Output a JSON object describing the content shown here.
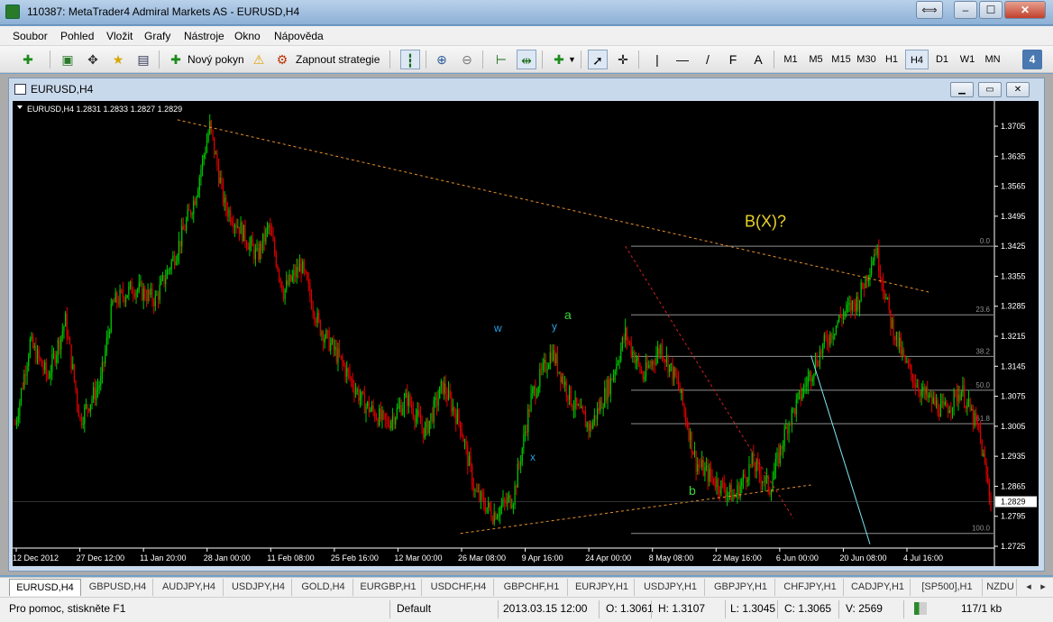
{
  "window": {
    "title": "110387: MetaTrader4 Admiral Markets AS - EURUSD,H4",
    "buttons": {
      "restore": "⟺",
      "minimize": "–",
      "maximize": "☐",
      "close": "✕"
    }
  },
  "menu": [
    "Soubor",
    "Pohled",
    "Vložit",
    "Grafy",
    "Nástroje",
    "Okno",
    "Nápověda"
  ],
  "toolbar": {
    "new_order": "Nový pokyn",
    "auto_trading": "Zapnout strategie",
    "tools": [
      "|",
      "—",
      "/",
      "F",
      "A"
    ],
    "timeframes": [
      "M1",
      "M5",
      "M15",
      "M30",
      "H1",
      "H4",
      "D1",
      "W1",
      "MN"
    ],
    "active_timeframe": "H4",
    "badge": "4"
  },
  "chart_window": {
    "title": "EURUSD,H4",
    "info_line": "EURUSD,H4  1.2831 1.2833 1.2827 1.2829"
  },
  "chart_data": {
    "type": "candlestick",
    "symbol": "EURUSD",
    "timeframe": "H4",
    "ohlc": [
      1.2831,
      1.2833,
      1.2827,
      1.2829
    ],
    "ylim": [
      1.2725,
      1.3705
    ],
    "y_ticks": [
      "1.3705",
      "1.3635",
      "1.3565",
      "1.3495",
      "1.3425",
      "1.3355",
      "1.3285",
      "1.3215",
      "1.3145",
      "1.3075",
      "1.3005",
      "1.2935",
      "1.2865",
      "1.2795",
      "1.2725"
    ],
    "current_price": "1.2829",
    "x_ticks": [
      "12 Dec 2012",
      "27 Dec 12:00",
      "11 Jan 20:00",
      "28 Jan 00:00",
      "11 Feb 08:00",
      "25 Feb 16:00",
      "12 Mar 00:00",
      "26 Mar 08:00",
      "9 Apr 16:00",
      "24 Apr 00:00",
      "8 May 08:00",
      "22 May 16:00",
      "6 Jun 00:00",
      "20 Jun 08:00",
      "4 Jul 16:00"
    ],
    "fib_levels": [
      {
        "label": "0.0",
        "price": 1.3425
      },
      {
        "label": "23.6",
        "price": 1.3265
      },
      {
        "label": "38.2",
        "price": 1.3168
      },
      {
        "label": "50.0",
        "price": 1.3089
      },
      {
        "label": "61.8",
        "price": 1.3011
      },
      {
        "label": "100.0",
        "price": 1.2755
      }
    ],
    "annotations": [
      {
        "text": "B(X)?",
        "color": "#e8d22a"
      },
      {
        "text": "a",
        "color": "#3cd43c"
      },
      {
        "text": "b",
        "color": "#3cd43c"
      },
      {
        "text": "w",
        "color": "#2a9fe0"
      },
      {
        "text": "x",
        "color": "#2a9fe0"
      },
      {
        "text": "y",
        "color": "#2a9fe0"
      }
    ],
    "colors": {
      "up": "#00c800",
      "down": "#e00000",
      "background": "#000000",
      "trendline": "#e8902a",
      "channel": "#7fe6f0"
    }
  },
  "tabs": [
    "EURUSD,H4",
    "GBPUSD,H4",
    "AUDJPY,H4",
    "USDJPY,H4",
    "GOLD,H4",
    "EURGBP,H1",
    "USDCHF,H4",
    "GBPCHF,H1",
    "EURJPY,H1",
    "USDJPY,H1",
    "GBPJPY,H1",
    "CHFJPY,H1",
    "CADJPY,H1",
    "[SP500],H1",
    "NZDU"
  ],
  "active_tab": "EURUSD,H4",
  "status": {
    "help": "Pro pomoc, stiskněte F1",
    "profile": "Default",
    "datetime": "2013.03.15 12:00",
    "open": "O: 1.3061",
    "high": "H: 1.3107",
    "low": "L: 1.3045",
    "close": "C: 1.3065",
    "volume": "V: 2569",
    "traffic": "117/1 kb"
  }
}
